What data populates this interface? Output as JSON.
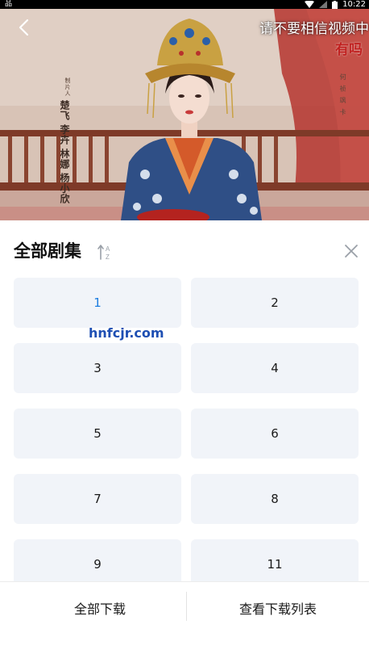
{
  "status_bar": {
    "time": "10:22",
    "left_glyph": "品"
  },
  "video": {
    "overlay_line1": "请不要相信视频中",
    "overlay_line2": "有吗",
    "credit_cast_title": "制片人",
    "credit_cast_names": [
      "杨小欣",
      "林娜",
      "李卉",
      "楚飞"
    ],
    "credit_right": "何 祯 飒 卡"
  },
  "panel": {
    "title": "全部剧集",
    "sort_icon_label_top": "A",
    "sort_icon_label_bottom": "Z",
    "episodes": [
      "1",
      "2",
      "3",
      "4",
      "5",
      "6",
      "7",
      "8",
      "9",
      "11"
    ],
    "selected_episode": "1"
  },
  "watermark": "hnfcjr.com",
  "bottom": {
    "download_all": "全部下载",
    "view_download_list": "查看下载列表"
  },
  "colors": {
    "accent_blue": "#1e7ee0",
    "episode_bg": "#f1f4f9",
    "overlay_red": "#c0201f"
  },
  "icons": [
    "back-icon",
    "sort-az-icon",
    "close-icon",
    "wifi-icon",
    "signal-icon",
    "battery-icon"
  ]
}
